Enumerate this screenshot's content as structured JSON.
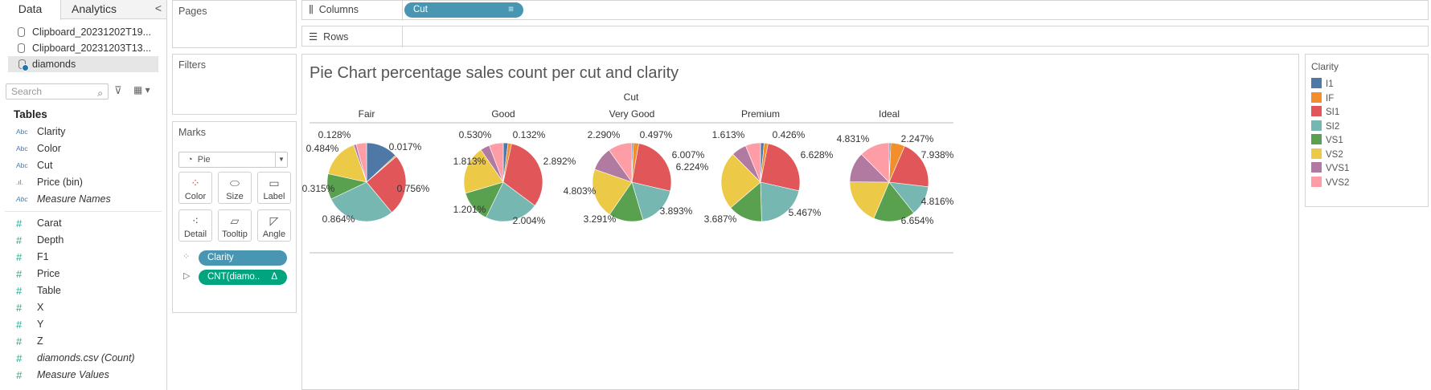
{
  "tabs": {
    "data": "Data",
    "analytics": "Analytics",
    "collapse": "<"
  },
  "datasources": [
    "Clipboard_20231202T19...",
    "Clipboard_20231203T13...",
    "diamonds"
  ],
  "search": {
    "placeholder": "Search"
  },
  "tables_header": "Tables",
  "dimensions": [
    {
      "type": "Abc",
      "name": "Clarity",
      "italic": false
    },
    {
      "type": "Abc",
      "name": "Color",
      "italic": false
    },
    {
      "type": "Abc",
      "name": "Cut",
      "italic": false
    },
    {
      "type": "bin",
      "name": "Price (bin)",
      "italic": false
    },
    {
      "type": "Abc",
      "name": "Measure Names",
      "italic": true
    }
  ],
  "measures": [
    {
      "name": "Carat",
      "italic": false
    },
    {
      "name": "Depth",
      "italic": false
    },
    {
      "name": "F1",
      "italic": false
    },
    {
      "name": "Price",
      "italic": false
    },
    {
      "name": "Table",
      "italic": false
    },
    {
      "name": "X",
      "italic": false
    },
    {
      "name": "Y",
      "italic": false
    },
    {
      "name": "Z",
      "italic": false
    },
    {
      "name": "diamonds.csv (Count)",
      "italic": true
    },
    {
      "name": "Measure Values",
      "italic": true
    }
  ],
  "cards": {
    "pages": "Pages",
    "filters": "Filters",
    "marks": "Marks"
  },
  "marks": {
    "type": "Pie",
    "buttons": [
      "Color",
      "Size",
      "Label",
      "Detail",
      "Tooltip",
      "Angle"
    ],
    "pills": {
      "color": "Clarity",
      "angle": "CNT(diamo..",
      "angle_delta": "Δ"
    }
  },
  "shelves": {
    "columns_label": "Columns",
    "columns_pill": "Cut",
    "rows_label": "Rows"
  },
  "legend": {
    "title": "Clarity"
  },
  "chart_data": {
    "type": "pie",
    "title": "Pie Chart percentage sales count per cut and clarity",
    "column_header": "Cut",
    "categories": [
      "Fair",
      "Good",
      "Very Good",
      "Premium",
      "Ideal"
    ],
    "clarity_levels": [
      "I1",
      "IF",
      "SI1",
      "SI2",
      "VS1",
      "VS2",
      "VVS1",
      "VVS2"
    ],
    "colors": [
      "#4e79a7",
      "#f28e2b",
      "#e15759",
      "#76b7b2",
      "#59a14f",
      "#edc948",
      "#b07aa1",
      "#ff9da7"
    ],
    "series": [
      {
        "cut": "Fair",
        "values": [
          0.391,
          0.017,
          0.756,
          0.864,
          0.315,
          0.484,
          0.032,
          0.128
        ]
      },
      {
        "cut": "Good",
        "values": [
          0.178,
          0.132,
          2.892,
          2.004,
          1.201,
          1.813,
          0.345,
          0.53
        ]
      },
      {
        "cut": "Very Good",
        "values": [
          0.156,
          0.497,
          6.007,
          3.893,
          3.291,
          4.803,
          2.29,
          2.29
        ]
      },
      {
        "cut": "Premium",
        "values": [
          0.38,
          0.426,
          6.628,
          5.467,
          3.687,
          6.224,
          1.613,
          1.613
        ]
      },
      {
        "cut": "Ideal",
        "values": [
          0.271,
          2.247,
          7.938,
          4.816,
          6.654,
          7.284,
          4.831,
          4.831
        ]
      }
    ],
    "labels": [
      [
        "0.128%",
        "0.017%",
        "0.484%",
        "0.756%",
        "0.315%",
        "0.864%"
      ],
      [
        "0.530%",
        "0.132%",
        "1.813%",
        "2.892%",
        "1.201%",
        "2.004%"
      ],
      [
        "2.290%",
        "0.497%",
        "6.007%",
        "4.803%",
        "3.291%",
        "3.893%"
      ],
      [
        "1.613%",
        "0.426%",
        "6.628%",
        "6.224%",
        "3.687%",
        "5.467%"
      ],
      [
        "4.831%",
        "2.247%",
        "7.938%",
        "4.816%",
        "6.654%"
      ]
    ]
  }
}
